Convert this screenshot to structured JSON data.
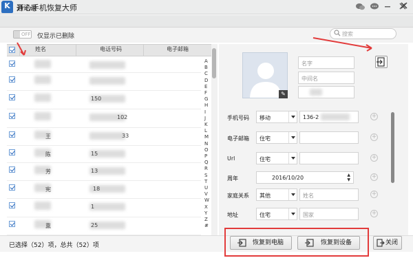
{
  "app": {
    "title": "开心手机恢复大师",
    "logo_letter": "K"
  },
  "dialog": {
    "title": "通讯录",
    "logo_letter": "K"
  },
  "toolbar": {
    "toggle_label": "OFF",
    "only_deleted_label": "仅显示已删除",
    "search_placeholder": "搜索"
  },
  "table": {
    "columns": [
      "姓名",
      "电话号码",
      "电子邮箱"
    ],
    "rows": [
      {
        "name": "",
        "phone": ""
      },
      {
        "name": "",
        "phone": ""
      },
      {
        "name": "",
        "phone": "150"
      },
      {
        "name": "",
        "phone": "102"
      },
      {
        "name": "王",
        "phone": "33"
      },
      {
        "name": "陈",
        "phone": "15"
      },
      {
        "name": "芳",
        "phone": "13"
      },
      {
        "name": "宪",
        "phone": "18"
      },
      {
        "name": "",
        "phone": "1"
      },
      {
        "name": "熏",
        "phone": "25"
      }
    ],
    "alphabet": [
      "A",
      "B",
      "C",
      "D",
      "E",
      "F",
      "G",
      "H",
      "I",
      "J",
      "K",
      "L",
      "M",
      "N",
      "O",
      "P",
      "Q",
      "R",
      "S",
      "T",
      "U",
      "V",
      "W",
      "X",
      "Y",
      "Z",
      "#"
    ]
  },
  "status": {
    "text": "已选择（52）项，总共（52）项"
  },
  "detail": {
    "name_placeholders": [
      "名字",
      "中间名"
    ],
    "fields": [
      {
        "label": "手机号码",
        "type": "移动",
        "value": "136-2"
      },
      {
        "label": "电子邮箱",
        "type": "住宅",
        "value": ""
      },
      {
        "label": "Url",
        "type": "住宅",
        "value": ""
      },
      {
        "label": "周年",
        "type": "",
        "value": "2016/10/20"
      },
      {
        "label": "家庭关系",
        "type": "其他",
        "value": "姓名"
      },
      {
        "label": "地址",
        "type": "住宅",
        "value": "国家"
      }
    ]
  },
  "buttons": {
    "restore_pc": "恢复到电脑",
    "restore_device": "恢复到设备",
    "close": "关闭"
  },
  "colors": {
    "accent": "#2d6fc0",
    "highlight": "#e23b3b"
  }
}
